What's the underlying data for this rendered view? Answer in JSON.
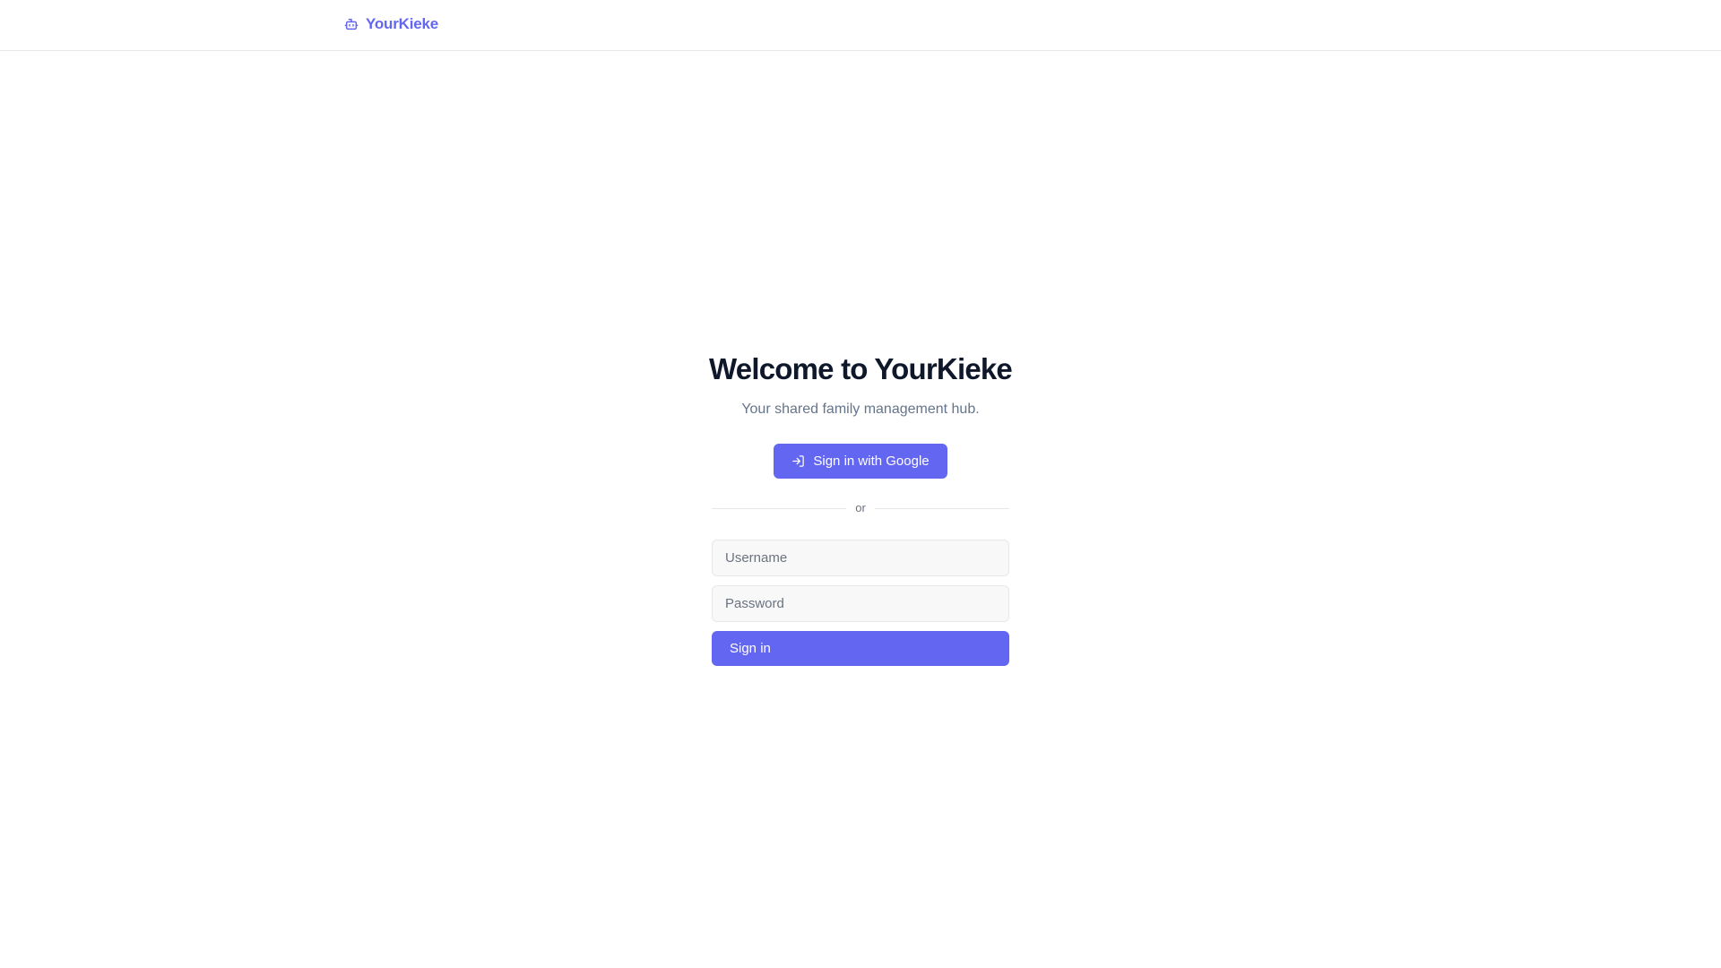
{
  "header": {
    "brand_name": "YourKieke",
    "brand_icon": "robot-icon"
  },
  "main": {
    "title": "Welcome to YourKieke",
    "subtitle": "Your shared family management hub.",
    "google_button": {
      "label": "Sign in with Google",
      "icon": "sign-in-icon"
    },
    "divider_text": "or",
    "username": {
      "placeholder": "Username",
      "value": ""
    },
    "password": {
      "placeholder": "Password",
      "value": ""
    },
    "signin_label": "Sign in"
  },
  "colors": {
    "accent": "#6366f1",
    "title": "#0f172a",
    "muted": "#64748b",
    "border": "#e5e7eb"
  }
}
